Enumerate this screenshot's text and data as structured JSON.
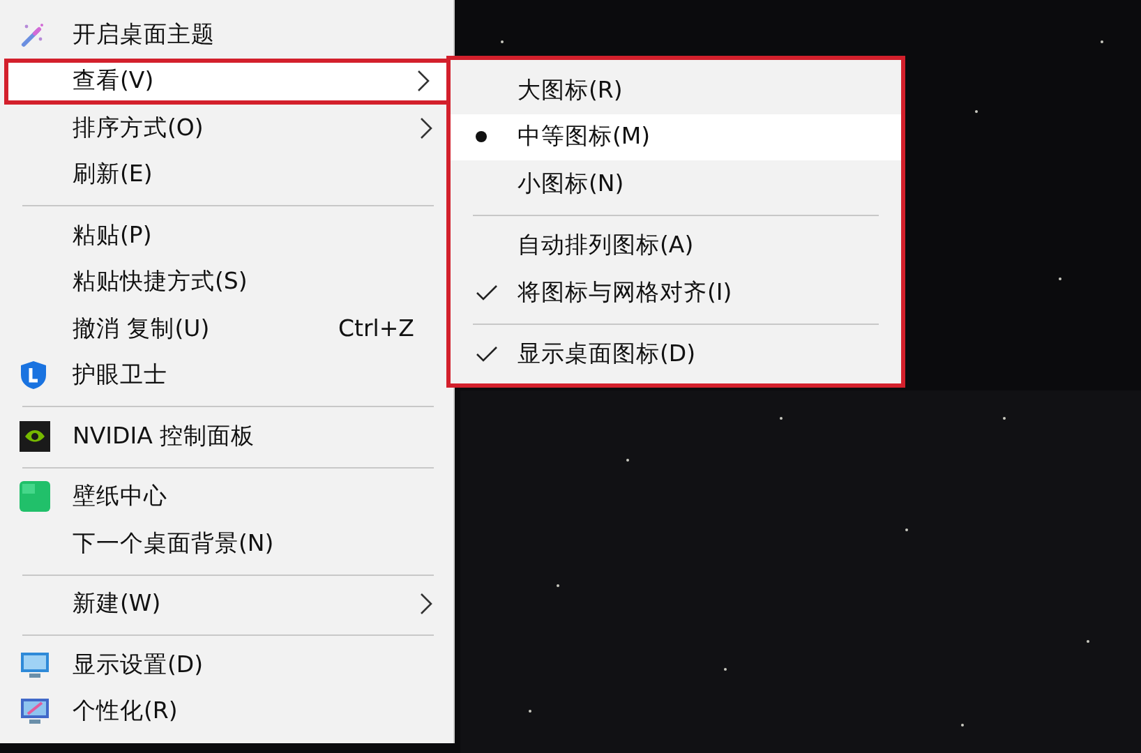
{
  "context_menu": {
    "items": [
      {
        "kind": "item",
        "label": "开启桌面主题",
        "highlighted": false,
        "submenu": false
      },
      {
        "kind": "item",
        "label": "查看(V)",
        "highlighted": true,
        "submenu": true
      },
      {
        "kind": "item",
        "label": "排序方式(O)",
        "highlighted": false,
        "submenu": true
      },
      {
        "kind": "item",
        "label": "刷新(E)",
        "highlighted": false,
        "submenu": false
      },
      {
        "kind": "separator"
      },
      {
        "kind": "item",
        "label": "粘贴(P)",
        "highlighted": false,
        "submenu": false
      },
      {
        "kind": "item",
        "label": "粘贴快捷方式(S)",
        "highlighted": false,
        "submenu": false
      },
      {
        "kind": "item",
        "label": "撤消 复制(U)",
        "shortcut": "Ctrl+Z",
        "highlighted": false,
        "submenu": false
      },
      {
        "kind": "item",
        "label": "护眼卫士",
        "highlighted": false,
        "submenu": false
      },
      {
        "kind": "separator"
      },
      {
        "kind": "item",
        "label": "NVIDIA 控制面板",
        "highlighted": false,
        "submenu": false
      },
      {
        "kind": "separator"
      },
      {
        "kind": "item",
        "label": "壁纸中心",
        "highlighted": false,
        "submenu": false
      },
      {
        "kind": "item",
        "label": "下一个桌面背景(N)",
        "highlighted": false,
        "submenu": false
      },
      {
        "kind": "separator"
      },
      {
        "kind": "item",
        "label": "新建(W)",
        "highlighted": false,
        "submenu": true
      },
      {
        "kind": "separator"
      },
      {
        "kind": "item",
        "label": "显示设置(D)",
        "highlighted": false,
        "submenu": false
      },
      {
        "kind": "item",
        "label": "个性化(R)",
        "highlighted": false,
        "submenu": false
      }
    ]
  },
  "view_submenu": {
    "highlighted": true,
    "items": [
      {
        "kind": "radio",
        "label": "大图标(R)",
        "selected": false,
        "hovered": false
      },
      {
        "kind": "radio",
        "label": "中等图标(M)",
        "selected": true,
        "hovered": true
      },
      {
        "kind": "radio",
        "label": "小图标(N)",
        "selected": false,
        "hovered": false
      },
      {
        "kind": "separator"
      },
      {
        "kind": "check",
        "label": "自动排列图标(A)",
        "checked": false,
        "hovered": false
      },
      {
        "kind": "check",
        "label": "将图标与网格对齐(I)",
        "checked": true,
        "hovered": false
      },
      {
        "kind": "separator"
      },
      {
        "kind": "check",
        "label": "显示桌面图标(D)",
        "checked": true,
        "hovered": false
      }
    ]
  }
}
